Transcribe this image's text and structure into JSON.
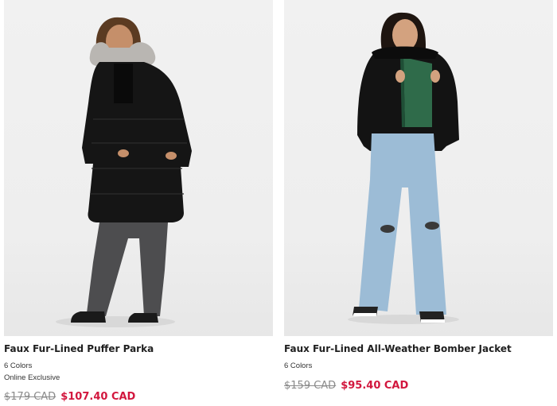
{
  "products": [
    {
      "image_alt": "woman wearing black faux fur-lined puffer parka",
      "name": "Faux Fur-Lined Puffer Parka",
      "colors": "6 Colors",
      "badge": "Online Exclusive",
      "original_price": "$179 CAD",
      "sale_price": "$107.40 CAD"
    },
    {
      "image_alt": "woman wearing black faux fur-lined all-weather bomber jacket",
      "name": "Faux Fur-Lined All-Weather Bomber Jacket",
      "colors": "6 Colors",
      "original_price": "$159 CAD",
      "sale_price": "$95.40 CAD"
    }
  ],
  "colors": {
    "sale": "#d2173e",
    "strike": "#8a8a8a",
    "photo_bg": "#efefef"
  }
}
